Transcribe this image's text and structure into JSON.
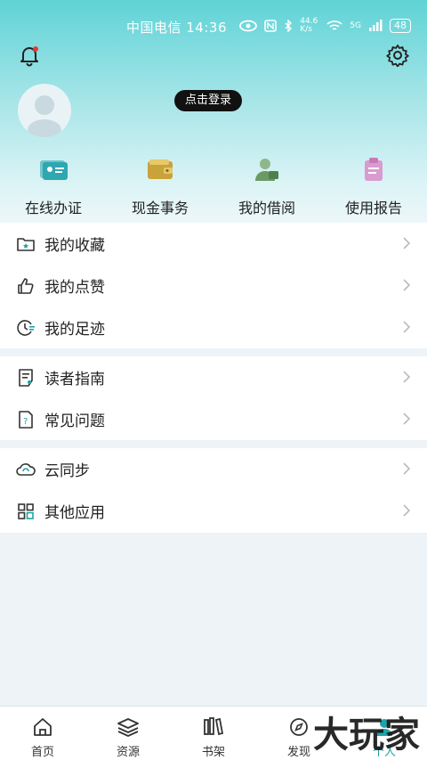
{
  "status_bar": {
    "left": "中国电信 14:36",
    "speed": "44.6 K/s",
    "net": "5G",
    "battery": "48"
  },
  "profile": {
    "login_label": "点击登录"
  },
  "quick_actions": [
    {
      "label": "在线办证",
      "icon": "id-card-icon",
      "color": "#2fa6b0"
    },
    {
      "label": "现金事务",
      "icon": "wallet-icon",
      "color": "#c9a23a"
    },
    {
      "label": "我的借阅",
      "icon": "reader-icon",
      "color": "#6b9a66"
    },
    {
      "label": "使用报告",
      "icon": "report-icon",
      "color": "#c67ab8"
    }
  ],
  "menu_groups": [
    [
      {
        "label": "我的收藏",
        "icon": "folder-star-icon"
      },
      {
        "label": "我的点赞",
        "icon": "thumbs-up-icon"
      },
      {
        "label": "我的足迹",
        "icon": "history-icon"
      }
    ],
    [
      {
        "label": "读者指南",
        "icon": "guide-icon"
      },
      {
        "label": "常见问题",
        "icon": "faq-icon"
      }
    ],
    [
      {
        "label": "云同步",
        "icon": "cloud-sync-icon"
      },
      {
        "label": "其他应用",
        "icon": "apps-grid-icon"
      }
    ]
  ],
  "tabbar": [
    {
      "label": "首页",
      "icon": "home-icon"
    },
    {
      "label": "资源",
      "icon": "layers-icon"
    },
    {
      "label": "书架",
      "icon": "bookshelf-icon"
    },
    {
      "label": "发现",
      "icon": "discover-icon"
    },
    {
      "label": "个人",
      "icon": "person-icon"
    }
  ],
  "watermark": "大玩家",
  "colors": {
    "accent": "#1fa3a8",
    "header_top": "#5fd3d6"
  }
}
